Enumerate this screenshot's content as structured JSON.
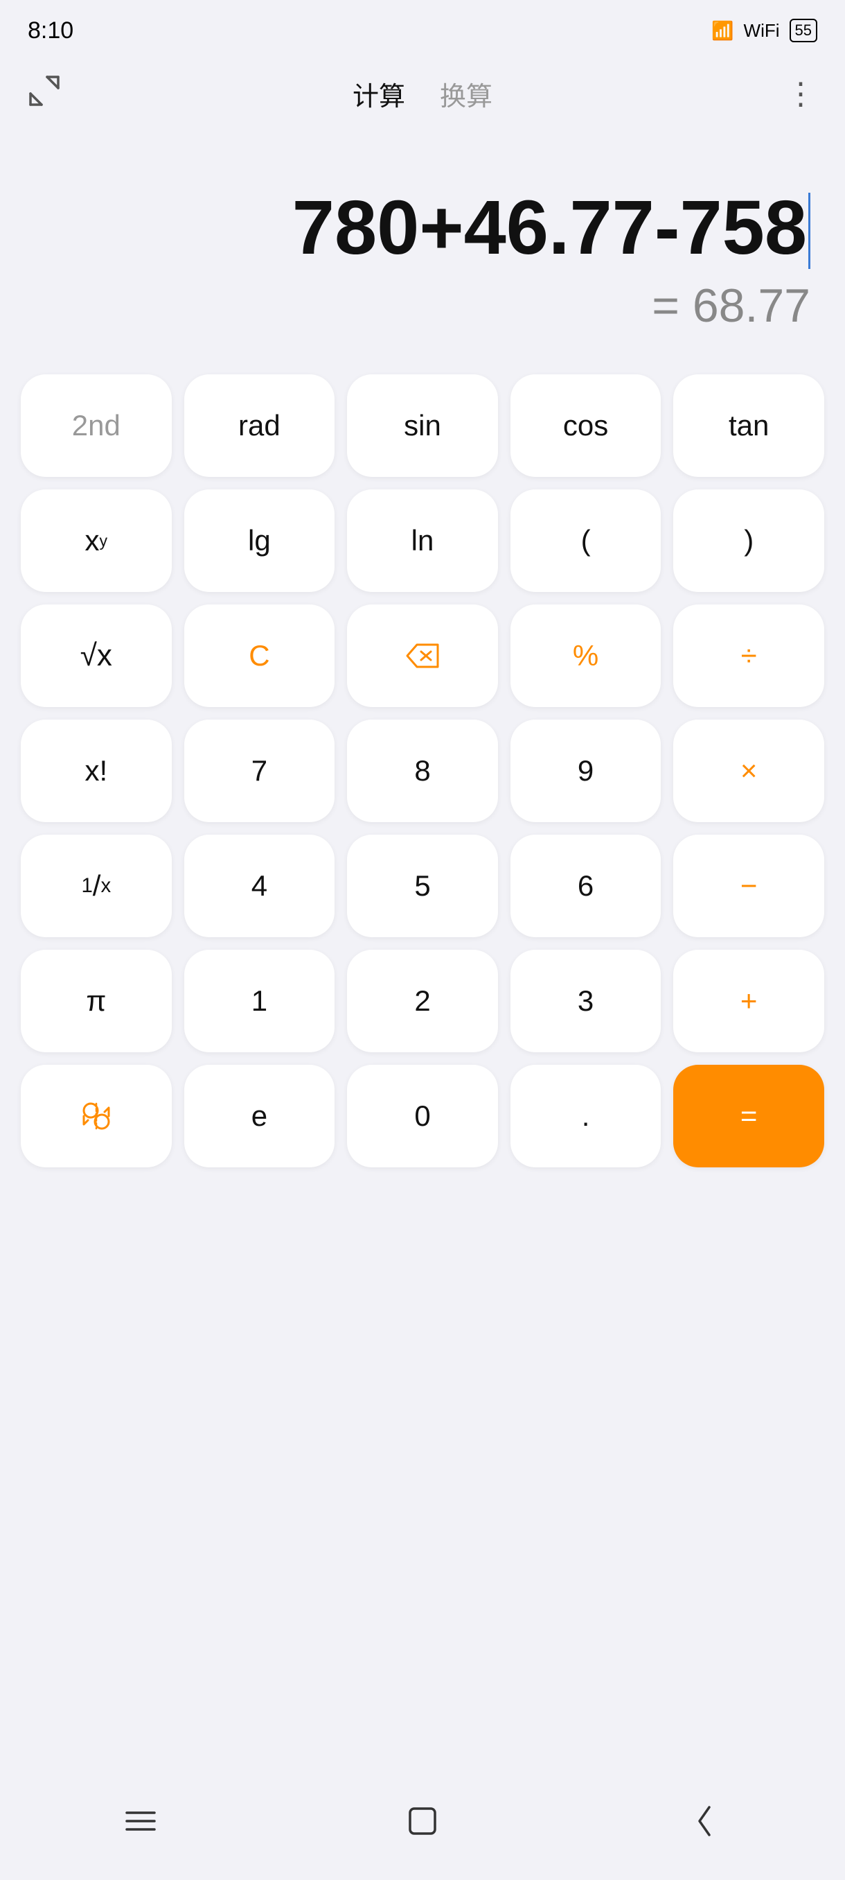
{
  "statusBar": {
    "time": "8:10",
    "battery": "55"
  },
  "header": {
    "collapseIcon": "↙↗",
    "navItems": [
      {
        "label": "计算",
        "active": true
      },
      {
        "label": "换算",
        "active": false
      }
    ],
    "moreIcon": "⋮"
  },
  "display": {
    "expression": "780+46.77-758",
    "result": "= 68.77"
  },
  "keyboard": {
    "rows": [
      [
        {
          "label": "2nd",
          "type": "gray-text"
        },
        {
          "label": "rad",
          "type": "normal"
        },
        {
          "label": "sin",
          "type": "normal"
        },
        {
          "label": "cos",
          "type": "normal"
        },
        {
          "label": "tan",
          "type": "normal"
        }
      ],
      [
        {
          "label": "xy",
          "type": "normal",
          "special": "xy"
        },
        {
          "label": "lg",
          "type": "normal"
        },
        {
          "label": "ln",
          "type": "normal"
        },
        {
          "label": "(",
          "type": "normal"
        },
        {
          "label": ")",
          "type": "normal"
        }
      ],
      [
        {
          "label": "√x",
          "type": "normal",
          "special": "sqrt"
        },
        {
          "label": "C",
          "type": "orange-text"
        },
        {
          "label": "⌫",
          "type": "orange-text",
          "special": "backspace"
        },
        {
          "label": "%",
          "type": "orange-text"
        },
        {
          "label": "÷",
          "type": "orange-text"
        }
      ],
      [
        {
          "label": "x!",
          "type": "normal"
        },
        {
          "label": "7",
          "type": "normal"
        },
        {
          "label": "8",
          "type": "normal"
        },
        {
          "label": "9",
          "type": "normal"
        },
        {
          "label": "×",
          "type": "orange-text"
        }
      ],
      [
        {
          "label": "1/x",
          "type": "normal",
          "special": "reciprocal"
        },
        {
          "label": "4",
          "type": "normal"
        },
        {
          "label": "5",
          "type": "normal"
        },
        {
          "label": "6",
          "type": "normal"
        },
        {
          "label": "−",
          "type": "orange-text"
        }
      ],
      [
        {
          "label": "π",
          "type": "normal"
        },
        {
          "label": "1",
          "type": "normal"
        },
        {
          "label": "2",
          "type": "normal"
        },
        {
          "label": "3",
          "type": "normal"
        },
        {
          "label": "+",
          "type": "orange-text"
        }
      ],
      [
        {
          "label": "♻",
          "type": "orange-text",
          "special": "rand"
        },
        {
          "label": "e",
          "type": "normal"
        },
        {
          "label": "0",
          "type": "normal"
        },
        {
          "label": ".",
          "type": "normal"
        },
        {
          "label": "=",
          "type": "equals"
        }
      ]
    ]
  },
  "bottomNav": {
    "menuIcon": "☰",
    "homeIcon": "□",
    "backIcon": "‹"
  }
}
